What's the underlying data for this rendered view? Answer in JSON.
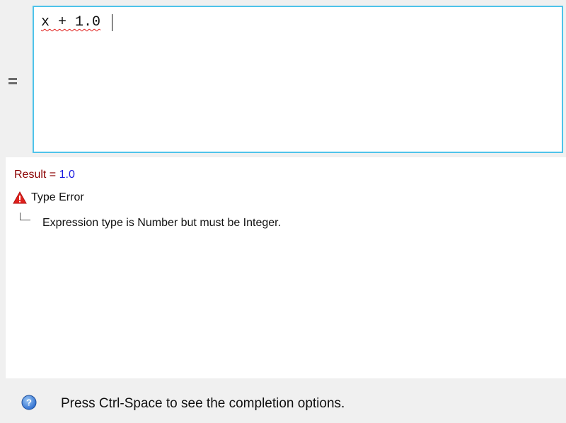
{
  "editor": {
    "expression": "x + 1.0"
  },
  "results": {
    "result_label": "Result",
    "equals": " = ",
    "result_value": "1.0",
    "error_title": "Type Error",
    "error_detail": "Expression type is Number but must be Integer."
  },
  "status_bar": {
    "hint": "Press Ctrl-Space to see the completion options."
  },
  "icons": {
    "gutter": "drag-handle-icon",
    "error": "warning-icon",
    "help": "help-icon"
  },
  "colors": {
    "focus_border": "#4ec3ea",
    "result_label": "#8b0000",
    "result_value": "#1a1adf",
    "error_icon": "#e0201c",
    "help_icon": "#2f6fd0"
  }
}
